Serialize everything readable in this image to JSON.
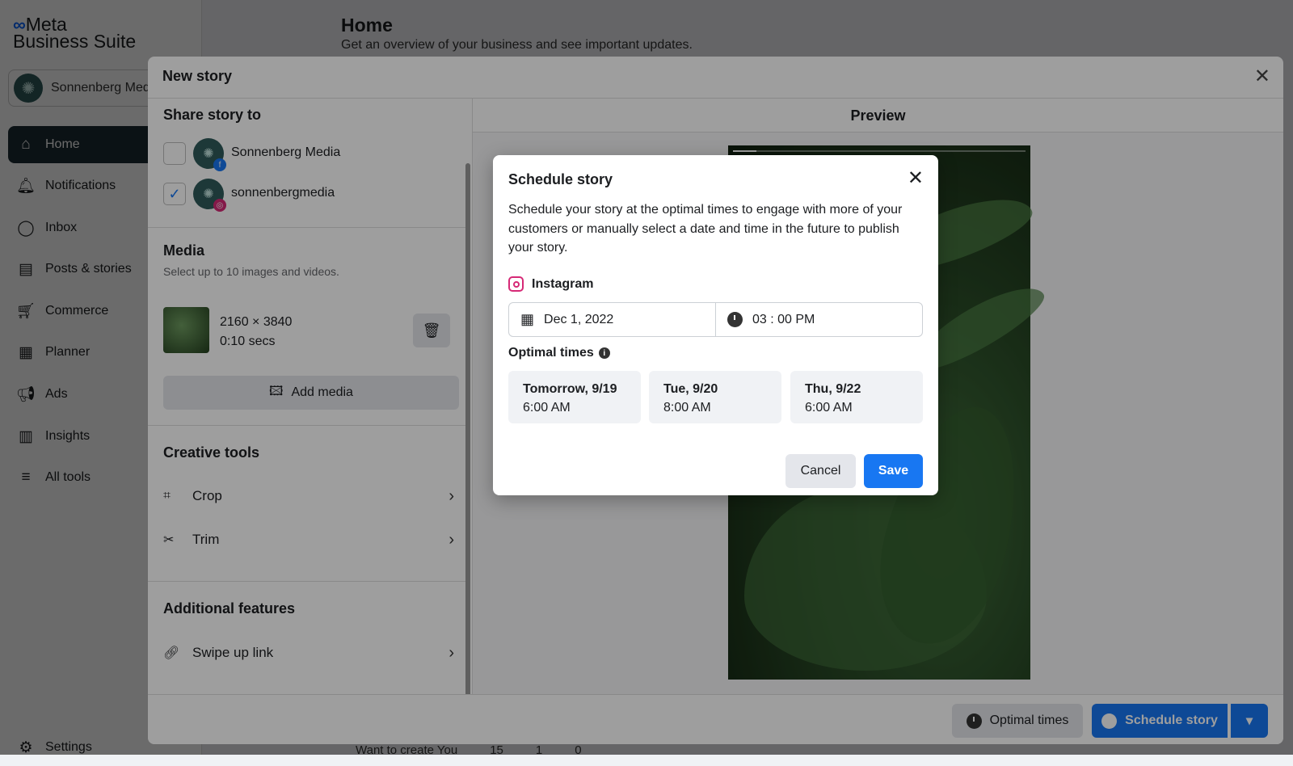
{
  "app": {
    "brand_line1": "Meta",
    "brand_line2": "Business Suite",
    "account": "Sonnenberg Media"
  },
  "sidebar": {
    "items": [
      {
        "label": "Home",
        "icon": "home-icon"
      },
      {
        "label": "Notifications",
        "icon": "bell-icon"
      },
      {
        "label": "Inbox",
        "icon": "chat-icon"
      },
      {
        "label": "Posts & stories",
        "icon": "posts-icon"
      },
      {
        "label": "Commerce",
        "icon": "cart-icon"
      },
      {
        "label": "Planner",
        "icon": "calendar-icon"
      },
      {
        "label": "Ads",
        "icon": "megaphone-icon"
      },
      {
        "label": "Insights",
        "icon": "bar-chart-icon"
      },
      {
        "label": "All tools",
        "icon": "menu-icon"
      }
    ],
    "settings": "Settings"
  },
  "header": {
    "title": "Home",
    "subtitle": "Get an overview of your business and see important updates."
  },
  "background_row": {
    "text": "Want to create You",
    "c1": "15",
    "c2": "1",
    "c3": "0"
  },
  "new_story": {
    "title": "New story",
    "share_to": "Share story to",
    "accounts": [
      {
        "name": "Sonnenberg Media",
        "checked": false,
        "platform": "facebook"
      },
      {
        "name": "sonnenbergmedia",
        "checked": true,
        "platform": "instagram"
      }
    ],
    "media": {
      "title": "Media",
      "subtitle": "Select up to 10 images and videos.",
      "dims": "2160 × 3840",
      "duration": "0:10 secs",
      "add": "Add media"
    },
    "creative_tools": {
      "title": "Creative tools",
      "items": [
        "Crop",
        "Trim"
      ]
    },
    "additional": {
      "title": "Additional features",
      "items": [
        "Swipe up link"
      ]
    },
    "preview": "Preview",
    "footer": {
      "optimal": "Optimal times",
      "schedule": "Schedule story"
    }
  },
  "schedule": {
    "title": "Schedule story",
    "description": "Schedule your story at the optimal times to engage with more of your customers or manually select a date and time in the future to publish your story.",
    "platform": "Instagram",
    "date": "Dec 1, 2022",
    "time": "03 : 00 PM",
    "optimal_label": "Optimal times",
    "slots": [
      {
        "day": "Tomorrow, 9/19",
        "time": "6:00 AM"
      },
      {
        "day": "Tue, 9/20",
        "time": "8:00 AM"
      },
      {
        "day": "Thu, 9/22",
        "time": "6:00 AM"
      }
    ],
    "cancel": "Cancel",
    "save": "Save",
    "colors": {
      "primary": "#1877f2",
      "instagram": "#d62976"
    }
  }
}
